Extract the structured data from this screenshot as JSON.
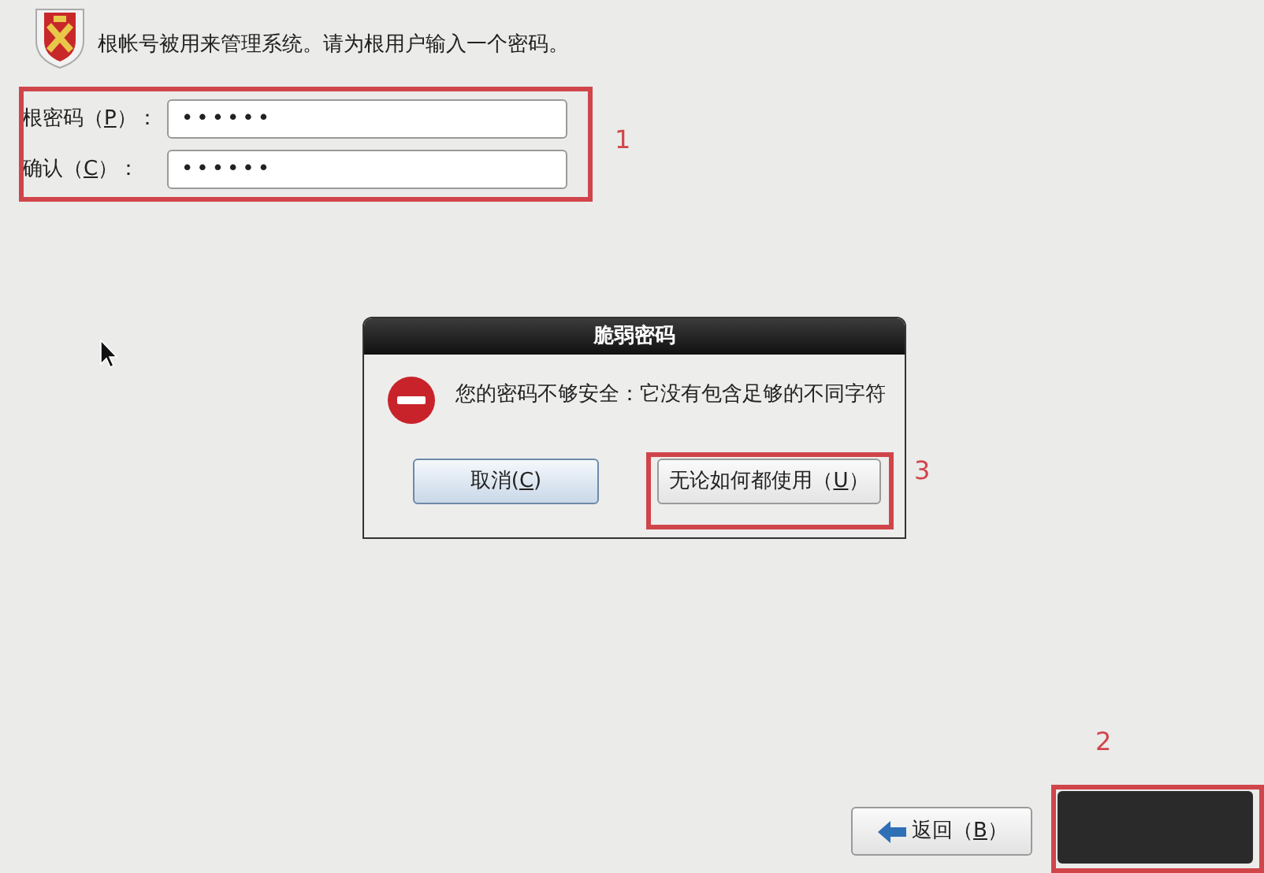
{
  "header": {
    "text": "根帐号被用来管理系统。请为根用户输入一个密码。"
  },
  "fields": [
    {
      "label": {
        "before": "根密码（",
        "key": "P",
        "after": "）："
      },
      "value": "••••••"
    },
    {
      "label": {
        "before": "确认（",
        "key": "C",
        "after": "）："
      },
      "value": "••••••"
    }
  ],
  "dialog": {
    "title": "脆弱密码",
    "message": "您的密码不够安全：它没有包含足够的不同字符",
    "buttons": [
      {
        "label": {
          "before": "取消(",
          "key": "C",
          "after": ")"
        },
        "default": true
      },
      {
        "label": {
          "before": "无论如何都使用（",
          "key": "U",
          "after": "）"
        },
        "default": false
      }
    ]
  },
  "nav_buttons": [
    {
      "kind": "back",
      "label": {
        "before": "返回（",
        "key": "B",
        "after": "）"
      }
    },
    {
      "kind": "next"
    }
  ],
  "annotations": [
    {
      "number": "1"
    },
    {
      "number": "2"
    },
    {
      "number": "3"
    }
  ]
}
